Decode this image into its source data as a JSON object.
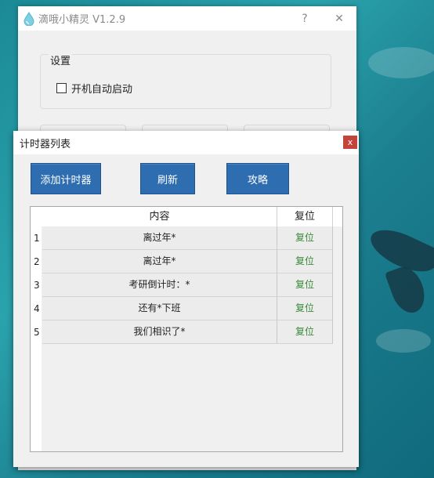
{
  "main_window": {
    "title": "滴哦小精灵 V1.2.9",
    "help_label": "?",
    "close_label": "✕",
    "settings": {
      "legend": "设置",
      "autostart_label": "开机自动启动",
      "autostart_checked": false
    }
  },
  "dialog": {
    "title": "计时器列表",
    "close_label": "x",
    "buttons": {
      "add": "添加计时器",
      "refresh": "刷新",
      "guide": "攻略"
    },
    "table": {
      "columns": [
        "内容",
        "复位"
      ],
      "rows": [
        {
          "num": "1",
          "content": "离过年*",
          "action": "复位"
        },
        {
          "num": "2",
          "content": "离过年*",
          "action": "复位"
        },
        {
          "num": "3",
          "content": "考研倒计时：*",
          "action": "复位"
        },
        {
          "num": "4",
          "content": "还有*下班",
          "action": "复位"
        },
        {
          "num": "5",
          "content": "我们相识了*",
          "action": "复位"
        }
      ]
    }
  },
  "colors": {
    "button_blue": "#2d6db0",
    "close_red": "#c4433a",
    "reset_green": "#3a8a3a"
  }
}
